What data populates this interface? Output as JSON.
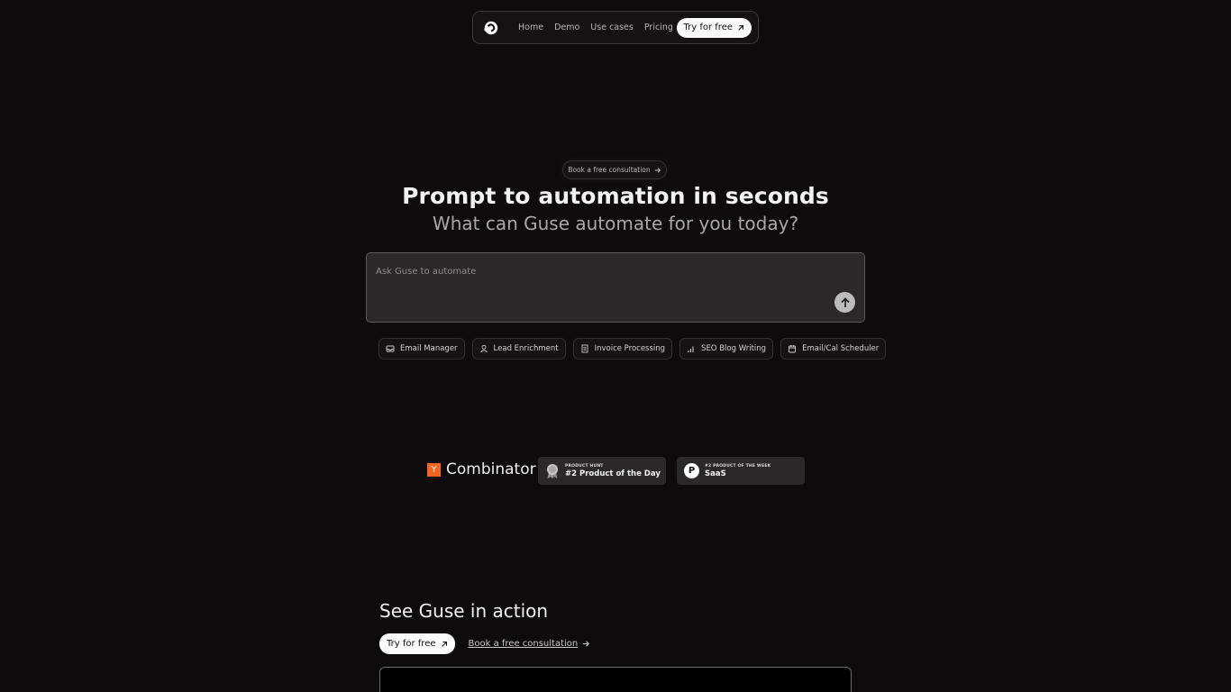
{
  "nav": {
    "links": [
      "Home",
      "Demo",
      "Use cases",
      "Pricing"
    ],
    "cta": "Try for free"
  },
  "hero": {
    "pill": "Book a free consultation",
    "title": "Prompt to automation in seconds",
    "subtitle": "What can Guse automate for you today?"
  },
  "prompt": {
    "placeholder": "Ask Guse to automate"
  },
  "chips": [
    {
      "label": "Email Manager",
      "icon": "inbox-icon"
    },
    {
      "label": "Lead Enrichment",
      "icon": "user-icon"
    },
    {
      "label": "Invoice Processing",
      "icon": "document-icon"
    },
    {
      "label": "SEO Blog Writing",
      "icon": "bar-chart-icon"
    },
    {
      "label": "Email/Cal Scheduler",
      "icon": "calendar-icon"
    }
  ],
  "badges": {
    "yc_letter": "Y",
    "yc_text": "Combinator",
    "ph_day_small": "PRODUCT HUNT",
    "ph_day_big": "#2 Product of the Day",
    "ph_week_small": "#2 PRODUCT OF THE WEEK",
    "ph_week_big": "SaaS",
    "ph_letter": "P"
  },
  "action": {
    "title": "See Guse in action",
    "cta": "Try for free",
    "consult": "Book a free consultation"
  },
  "colors": {
    "background": "#0d0b0c",
    "yc_orange": "#f26522",
    "badge_bg": "#2a2829"
  }
}
